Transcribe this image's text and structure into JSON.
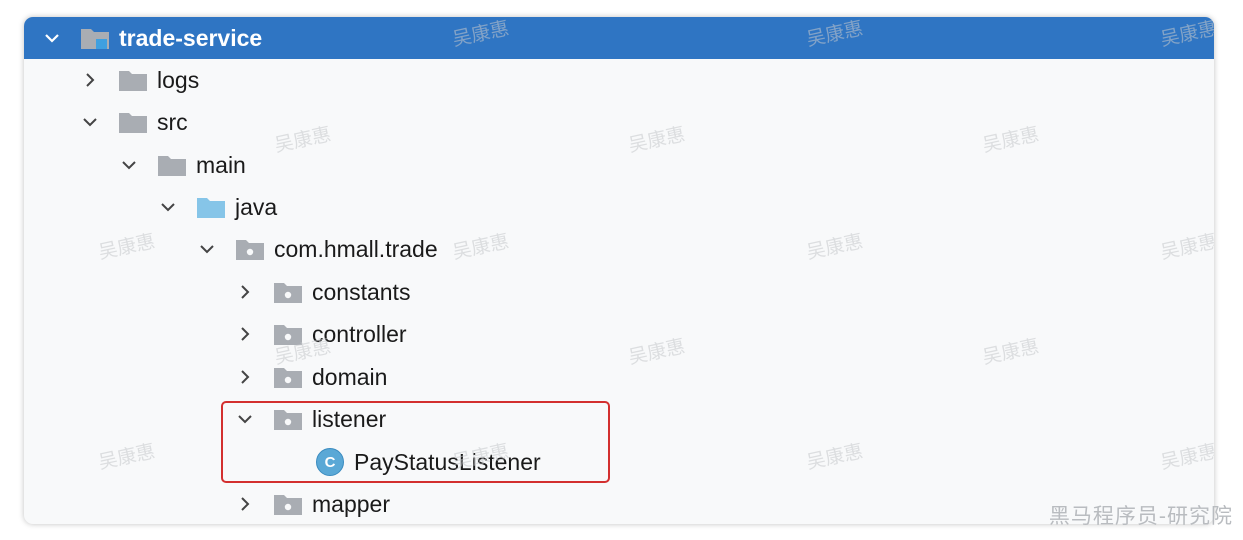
{
  "project_tree": {
    "root": {
      "label": "trade-service",
      "expanded": true,
      "selected": true
    },
    "nodes": [
      {
        "label": "logs",
        "expanded": false,
        "folder": "plain"
      },
      {
        "label": "src",
        "expanded": true,
        "folder": "plain"
      },
      {
        "label": "main",
        "expanded": true,
        "folder": "plain"
      },
      {
        "label": "java",
        "expanded": true,
        "folder": "source"
      },
      {
        "label": "com.hmall.trade",
        "expanded": true,
        "folder": "package"
      },
      {
        "label": "constants",
        "expanded": false,
        "folder": "package"
      },
      {
        "label": "controller",
        "expanded": false,
        "folder": "package"
      },
      {
        "label": "domain",
        "expanded": false,
        "folder": "package"
      },
      {
        "label": "listener",
        "expanded": true,
        "folder": "package"
      },
      {
        "label": "PayStatusListener",
        "type": "class",
        "class_badge": "C"
      },
      {
        "label": "mapper",
        "expanded": false,
        "folder": "package"
      }
    ]
  },
  "watermark": {
    "text": "吴康惠"
  },
  "brand": {
    "text": "黑马程序员-研究院"
  },
  "colors": {
    "selection": "#2f75c3",
    "highlight_border": "#d32f2f",
    "folder": "#a9adb3",
    "source_folder": "#86c5e8",
    "class_icon": "#5aa8d6"
  }
}
